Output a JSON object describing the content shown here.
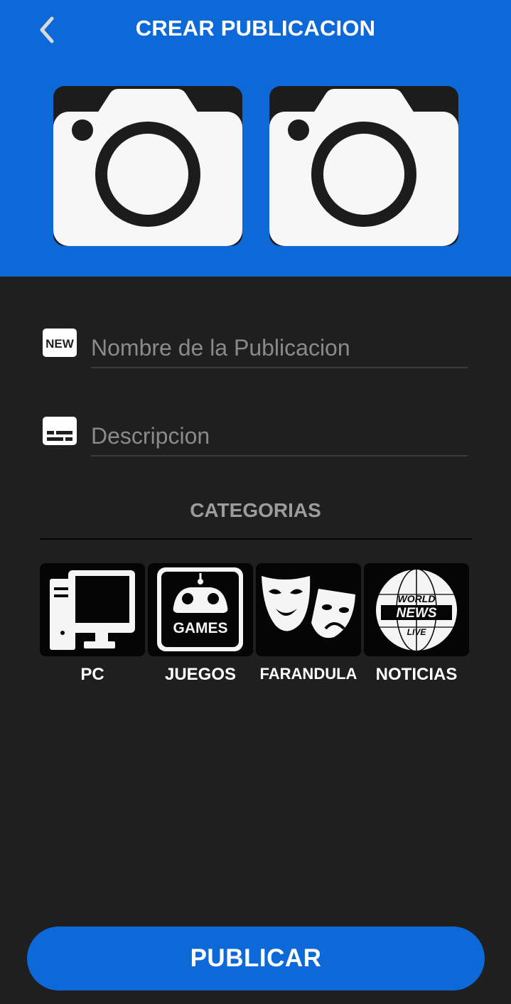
{
  "header": {
    "title": "CREAR PUBLICACION",
    "back_icon": "chevron-left-icon",
    "background_color": "#0d69d8"
  },
  "photos": [
    {
      "icon": "camera-icon"
    },
    {
      "icon": "camera-icon"
    }
  ],
  "form": {
    "name_field": {
      "icon": "new-badge-icon",
      "placeholder": "Nombre de la Publicacion",
      "value": ""
    },
    "description_field": {
      "icon": "subtitles-icon",
      "placeholder": "Descripcion",
      "value": ""
    }
  },
  "categories": {
    "title": "CATEGORIAS",
    "items": [
      {
        "label": "PC",
        "icon": "desktop-computer-icon"
      },
      {
        "label": "JUEGOS",
        "icon": "games-controller-icon",
        "icon_text": "GAMES"
      },
      {
        "label": "FARANDULA",
        "icon": "theater-masks-icon"
      },
      {
        "label": "NOTICIAS",
        "icon": "world-news-globe-icon",
        "icon_text": [
          "WORLD",
          "NEWS",
          "LIVE"
        ]
      }
    ]
  },
  "publish_button": {
    "label": "PUBLICAR",
    "color": "#0d69d8"
  }
}
